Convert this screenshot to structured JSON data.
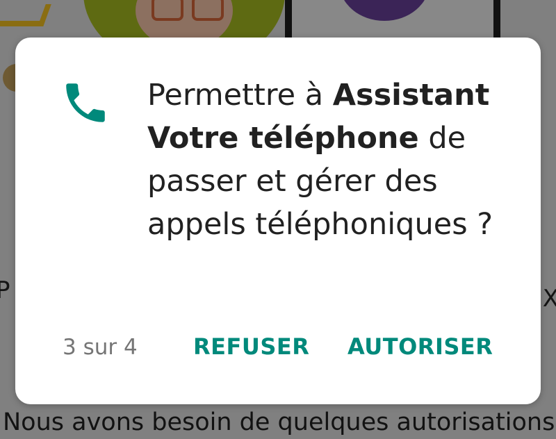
{
  "background": {
    "left_fragment": "P",
    "right_fragment": "IX",
    "bottom_text": "Nous avons besoin de quelques autorisations"
  },
  "dialog": {
    "icon": "phone-icon",
    "message_prefix": "Permettre à ",
    "app_name": "Assistant Votre téléphone",
    "message_suffix": " de passer et gérer des appels téléphoniques ?",
    "counter": "3 sur 4",
    "deny_label": "REFUSER",
    "allow_label": "AUTORISER"
  },
  "colors": {
    "accent": "#00897B",
    "scrim": "#808080",
    "dialog_bg": "#FFFFFF",
    "text": "#212121",
    "secondary_text": "#757575"
  }
}
